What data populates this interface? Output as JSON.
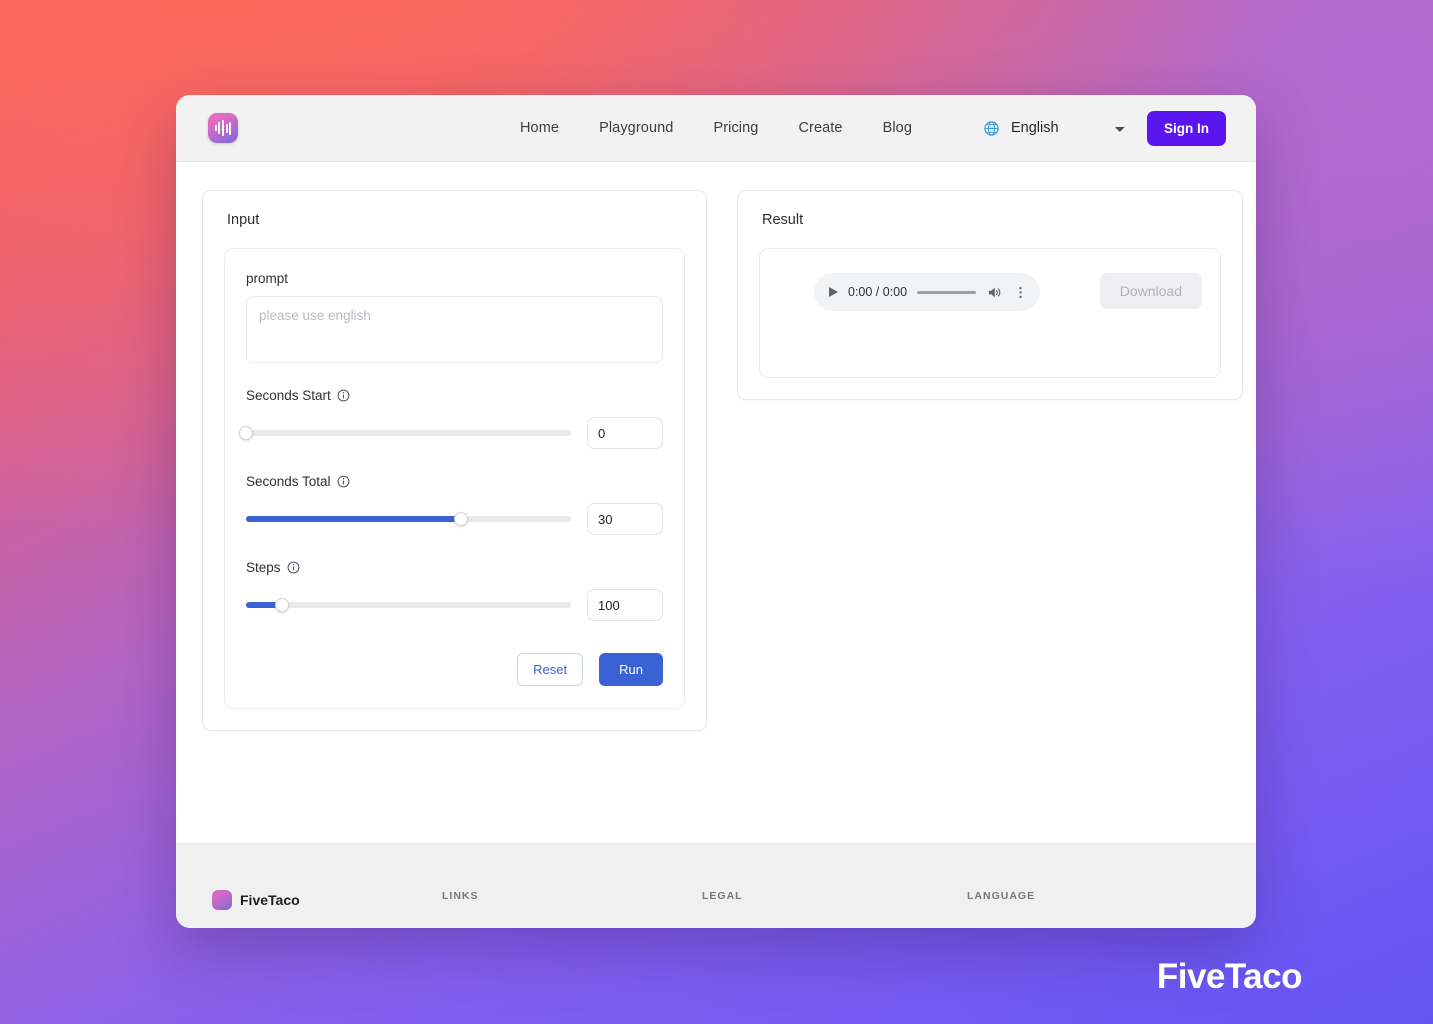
{
  "header": {
    "logo_icon": "audio-waveform-logo",
    "nav": [
      {
        "label": "Home"
      },
      {
        "label": "Playground"
      },
      {
        "label": "Pricing"
      },
      {
        "label": "Create"
      },
      {
        "label": "Blog"
      }
    ],
    "globe_icon": "globe-icon",
    "language": {
      "selected": "English",
      "options": [
        "English"
      ]
    },
    "signin_label": "Sign In"
  },
  "input_panel": {
    "title": "Input",
    "prompt": {
      "label": "prompt",
      "value": "",
      "placeholder": "please use english"
    },
    "sliders": [
      {
        "label": "Seconds Start",
        "info_icon": "info-icon",
        "value": "0",
        "percent": 0
      },
      {
        "label": "Seconds Total",
        "info_icon": "info-icon",
        "value": "30",
        "percent": 66
      },
      {
        "label": "Steps",
        "info_icon": "info-icon",
        "value": "100",
        "percent": 11
      }
    ],
    "reset_label": "Reset",
    "run_label": "Run"
  },
  "result_panel": {
    "title": "Result",
    "audio": {
      "play_icon": "play-icon",
      "time": "0:00 / 0:00",
      "volume_icon": "volume-icon",
      "menu_icon": "more-vertical-icon"
    },
    "download_label": "Download"
  },
  "footer": {
    "brand": "FiveTaco",
    "columns": [
      {
        "heading": "LINKS"
      },
      {
        "heading": "LEGAL"
      },
      {
        "heading": "LANGUAGE"
      }
    ]
  },
  "watermark": "FiveTaco",
  "colors": {
    "accent_blue": "#3b62d4",
    "signin_purple": "#5b16ef",
    "bg_coral": "#f4615f",
    "bg_purple": "#6355f5"
  }
}
